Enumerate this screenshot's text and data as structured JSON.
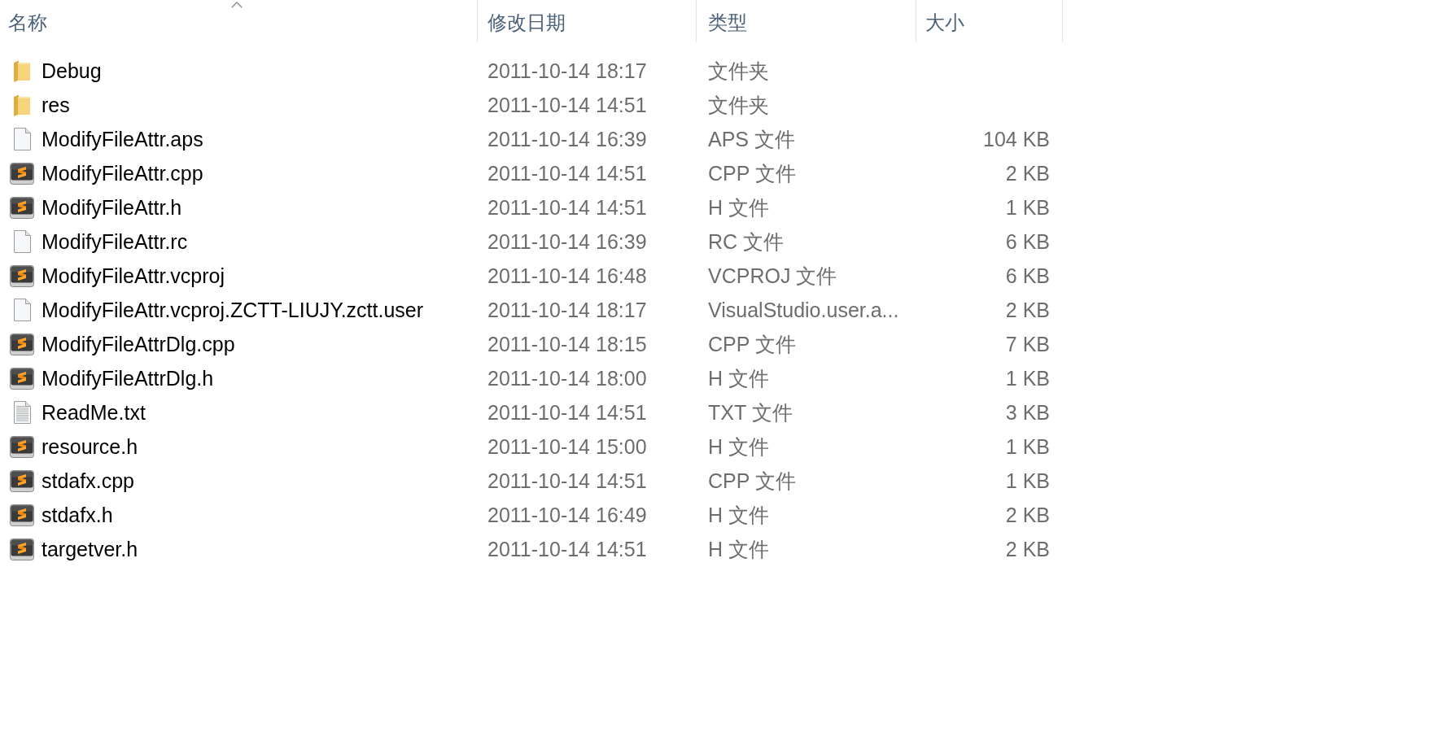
{
  "columns": [
    {
      "label": "名称",
      "sorted": true
    },
    {
      "label": "修改日期",
      "sorted": false
    },
    {
      "label": "类型",
      "sorted": false
    },
    {
      "label": "大小",
      "sorted": false
    }
  ],
  "files": [
    {
      "kind": "folder",
      "name": "Debug",
      "modified": "2011-10-14 18:17",
      "type": "文件夹"
    },
    {
      "kind": "folder",
      "name": "res",
      "modified": "2011-10-14 14:51",
      "type": "文件夹"
    },
    {
      "kind": "blank",
      "name": "ModifyFileAttr.aps",
      "modified": "2011-10-14 16:39",
      "type": "APS 文件",
      "size": "104 KB"
    },
    {
      "kind": "source",
      "name": "ModifyFileAttr.cpp",
      "modified": "2011-10-14 14:51",
      "type": "CPP 文件",
      "size": "2 KB"
    },
    {
      "kind": "source",
      "name": "ModifyFileAttr.h",
      "modified": "2011-10-14 14:51",
      "type": "H 文件",
      "size": "1 KB"
    },
    {
      "kind": "blank",
      "name": "ModifyFileAttr.rc",
      "modified": "2011-10-14 16:39",
      "type": "RC 文件",
      "size": "6 KB"
    },
    {
      "kind": "source",
      "name": "ModifyFileAttr.vcproj",
      "modified": "2011-10-14 16:48",
      "type": "VCPROJ 文件",
      "size": "6 KB"
    },
    {
      "kind": "blank",
      "name": "ModifyFileAttr.vcproj.ZCTT-LIUJY.zctt.user",
      "modified": "2011-10-14 18:17",
      "type": "VisualStudio.user.a...",
      "size": "2 KB"
    },
    {
      "kind": "source",
      "name": "ModifyFileAttrDlg.cpp",
      "modified": "2011-10-14 18:15",
      "type": "CPP 文件",
      "size": "7 KB"
    },
    {
      "kind": "source",
      "name": "ModifyFileAttrDlg.h",
      "modified": "2011-10-14 18:00",
      "type": "H 文件",
      "size": "1 KB"
    },
    {
      "kind": "text",
      "name": "ReadMe.txt",
      "modified": "2011-10-14 14:51",
      "type": "TXT 文件",
      "size": "3 KB"
    },
    {
      "kind": "source",
      "name": "resource.h",
      "modified": "2011-10-14 15:00",
      "type": "H 文件",
      "size": "1 KB"
    },
    {
      "kind": "source",
      "name": "stdafx.cpp",
      "modified": "2011-10-14 14:51",
      "type": "CPP 文件",
      "size": "1 KB"
    },
    {
      "kind": "source",
      "name": "stdafx.h",
      "modified": "2011-10-14 16:49",
      "type": "H 文件",
      "size": "2 KB"
    },
    {
      "kind": "source",
      "name": "targetver.h",
      "modified": "2011-10-14 14:51",
      "type": "H 文件",
      "size": "2 KB"
    }
  ]
}
